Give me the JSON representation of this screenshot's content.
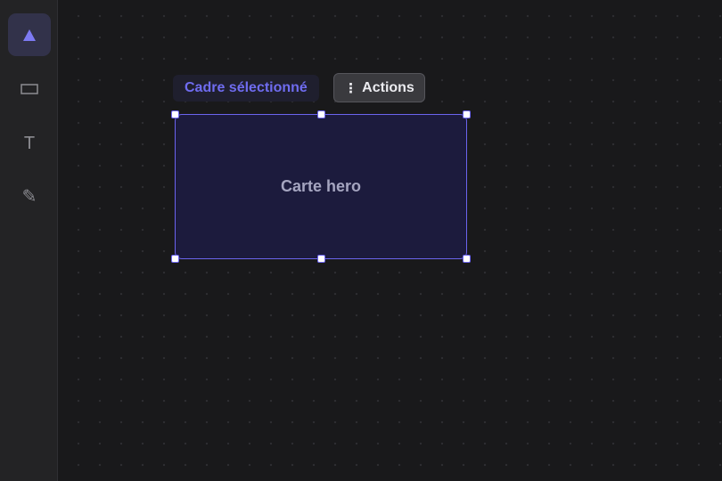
{
  "toolbar": {
    "tools": [
      {
        "name": "select",
        "icon": "select-triangle-icon",
        "active": true
      },
      {
        "name": "rectangle",
        "icon": "rectangle-icon",
        "active": false
      },
      {
        "name": "text",
        "icon": "text-icon",
        "glyph": "T",
        "active": false
      },
      {
        "name": "pencil",
        "icon": "pencil-icon",
        "glyph": "✎",
        "active": false
      }
    ]
  },
  "selection": {
    "label": "Cadre sélectionné",
    "actions_icon": "⋮",
    "actions_label": "Actions",
    "frame_title": "Carte hero"
  },
  "colors": {
    "accent": "#6b64ee",
    "frame_fill": "#1c1b3d",
    "canvas_bg": "#19191b",
    "toolbar_bg": "#232325"
  }
}
